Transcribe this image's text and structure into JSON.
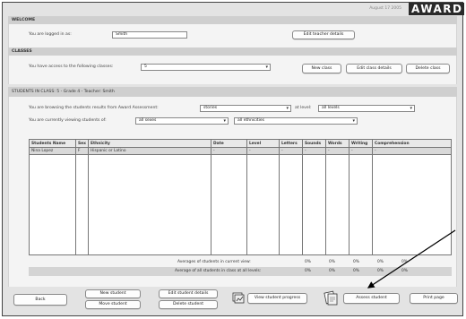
{
  "header": {
    "date": "August 17 2005",
    "logo": "AWARD"
  },
  "welcome": {
    "title": "WELCOME",
    "logged_in_label": "You are logged in as:",
    "user": "Smith",
    "edit_teacher_button": "Edit teacher details"
  },
  "classes": {
    "title": "CLASSES",
    "access_label": "You have access to the following classes:",
    "selected_class": "5",
    "new_class_button": "New class",
    "edit_class_button": "Edit class details",
    "delete_class_button": "Delete class"
  },
  "students": {
    "title": "STUDENTS IN CLASS:  5 - Grade 4 - Teacher: Smith",
    "browsing_label": "You are browsing the students results from Award Assessment:",
    "assessment": "stories",
    "level_label": "at level:",
    "level": "all levels",
    "viewing_label": "You are currently viewing students of:",
    "sexes": "all sexes",
    "ethnicities": "all ethnicities",
    "columns": [
      "Students Name",
      "Sex",
      "Ethnicity",
      "Date",
      "Level",
      "Letters",
      "Sounds",
      "Words",
      "Writing",
      "Comprehension"
    ],
    "rows": [
      [
        "Nina Lopez",
        "F",
        "Hispanic or Latino",
        "-",
        "-",
        "-",
        "-",
        "-",
        "-",
        "-"
      ]
    ],
    "avg_view_label": "Averages of students in current view:",
    "avg_all_label": "Average of all students in class at all levels:",
    "avg_view": [
      "0%",
      "0%",
      "0%",
      "0%",
      "0%"
    ],
    "avg_all": [
      "0%",
      "0%",
      "0%",
      "0%",
      "0%"
    ]
  },
  "footer": {
    "back": "Back",
    "new_student": "New student",
    "move_student": "Move student",
    "edit_student": "Edit student details",
    "delete_student": "Delete student",
    "view_progress": "View student progress",
    "assess": "Assess student",
    "print": "Print page"
  }
}
